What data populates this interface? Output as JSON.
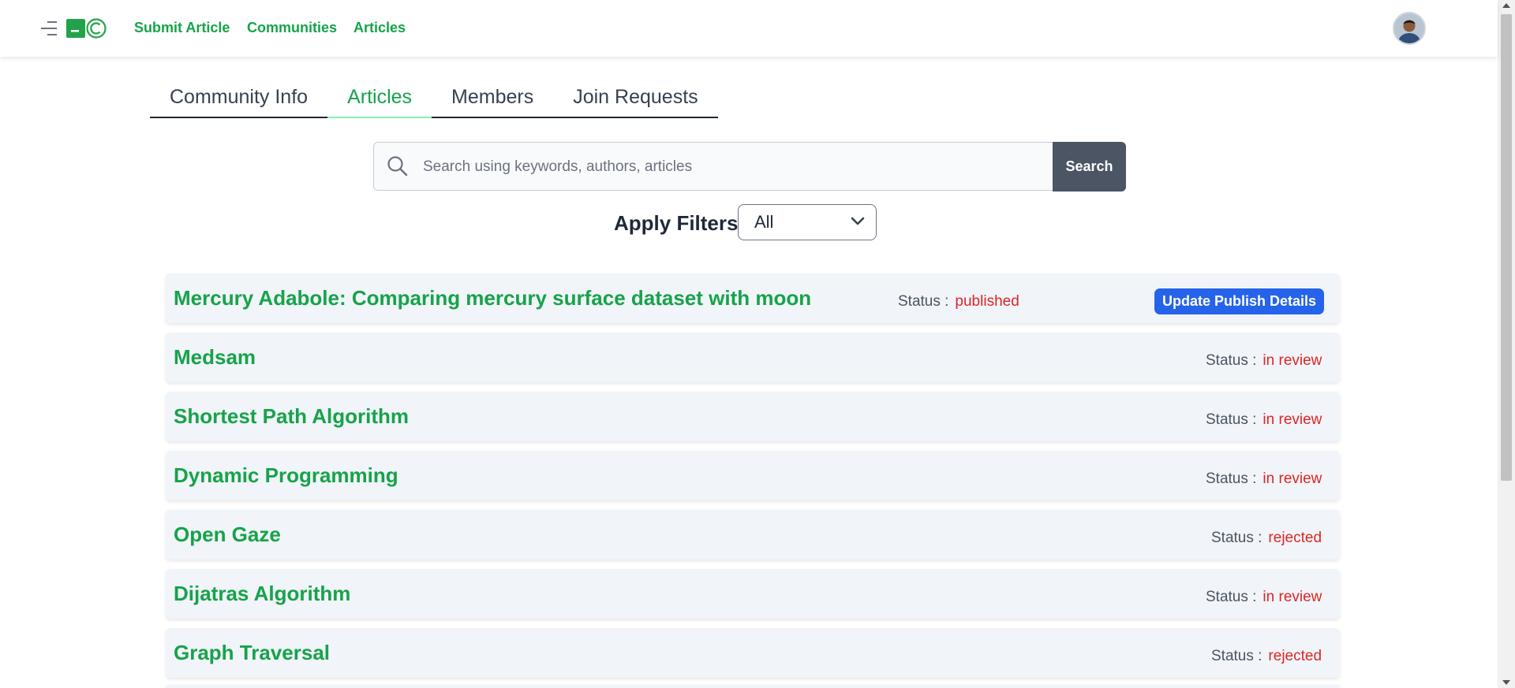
{
  "header": {
    "nav_links": [
      "Submit Article",
      "Communities",
      "Articles"
    ],
    "menu_icon": "hamburger-icon",
    "logo_icon": "app-logo-icon",
    "avatar_icon": "user-avatar"
  },
  "tabs": [
    {
      "label": "Community Info",
      "active": false
    },
    {
      "label": "Articles",
      "active": true
    },
    {
      "label": "Members",
      "active": false
    },
    {
      "label": "Join Requests",
      "active": false
    }
  ],
  "search": {
    "placeholder": "Search using keywords, authors, articles",
    "value": "",
    "button_label": "Search",
    "icon": "search-icon"
  },
  "filters": {
    "label": "Apply Filters:",
    "selected": "All"
  },
  "articles": [
    {
      "title": "Mercury Adabole: Comparing mercury surface dataset with moon",
      "status_label": "Status :",
      "status": "published",
      "action_label": "Update Publish Details"
    },
    {
      "title": "Medsam",
      "status_label": "Status :",
      "status": "in review"
    },
    {
      "title": "Shortest Path Algorithm",
      "status_label": "Status :",
      "status": "in review"
    },
    {
      "title": "Dynamic Programming",
      "status_label": "Status :",
      "status": "in review"
    },
    {
      "title": "Open Gaze",
      "status_label": "Status :",
      "status": "rejected"
    },
    {
      "title": "Dijatras Algorithm",
      "status_label": "Status :",
      "status": "in review"
    },
    {
      "title": "Graph Traversal",
      "status_label": "Status :",
      "status": "rejected"
    }
  ],
  "colors": {
    "brand": "#16a34a",
    "status_text": "#dc2626",
    "primary_button": "#2563eb",
    "search_button": "#4b5563"
  }
}
